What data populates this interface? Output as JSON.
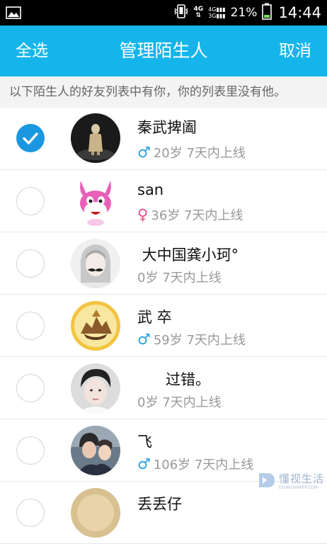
{
  "status_bar": {
    "network_top": "4G",
    "sim_lines": [
      "4G",
      "3G"
    ],
    "battery_percent": "21%",
    "time": "14:44"
  },
  "titlebar": {
    "select_all": "全选",
    "title": "管理陌生人",
    "cancel": "取消"
  },
  "notice": "以下陌生人的好友列表中有你，你的列表里没有他。",
  "contacts": [
    {
      "name": "秦武捭阖",
      "gender": "male",
      "gender_symbol": "♂",
      "age": "20岁",
      "online": "7天内上线",
      "checked": true
    },
    {
      "name": "san",
      "gender": "female",
      "gender_symbol": "♀",
      "age": "36岁",
      "online": "7天内上线",
      "checked": false
    },
    {
      "name": " 大中国龚小珂°",
      "gender": "",
      "gender_symbol": "",
      "age": "0岁",
      "online": "7天内上线",
      "checked": false
    },
    {
      "name": "武 卒",
      "gender": "male",
      "gender_symbol": "♂",
      "age": "59岁",
      "online": "7天内上线",
      "checked": false
    },
    {
      "name": "      过错。",
      "gender": "",
      "gender_symbol": "",
      "age": "0岁",
      "online": "7天内上线",
      "checked": false
    },
    {
      "name": "飞",
      "gender": "male",
      "gender_symbol": "♂",
      "age": "106岁",
      "online": "7天内上线",
      "checked": false
    },
    {
      "name": "丢丢仔",
      "gender": "",
      "gender_symbol": "",
      "age": "",
      "online": "",
      "checked": false
    }
  ],
  "watermark": {
    "chinese": "懂视生活",
    "english": "DONGSHIAPP.COM"
  },
  "colors": {
    "accent": "#15b5ec",
    "check": "#1a97e0",
    "male": "#2a9fe0",
    "female": "#f04a8a"
  }
}
